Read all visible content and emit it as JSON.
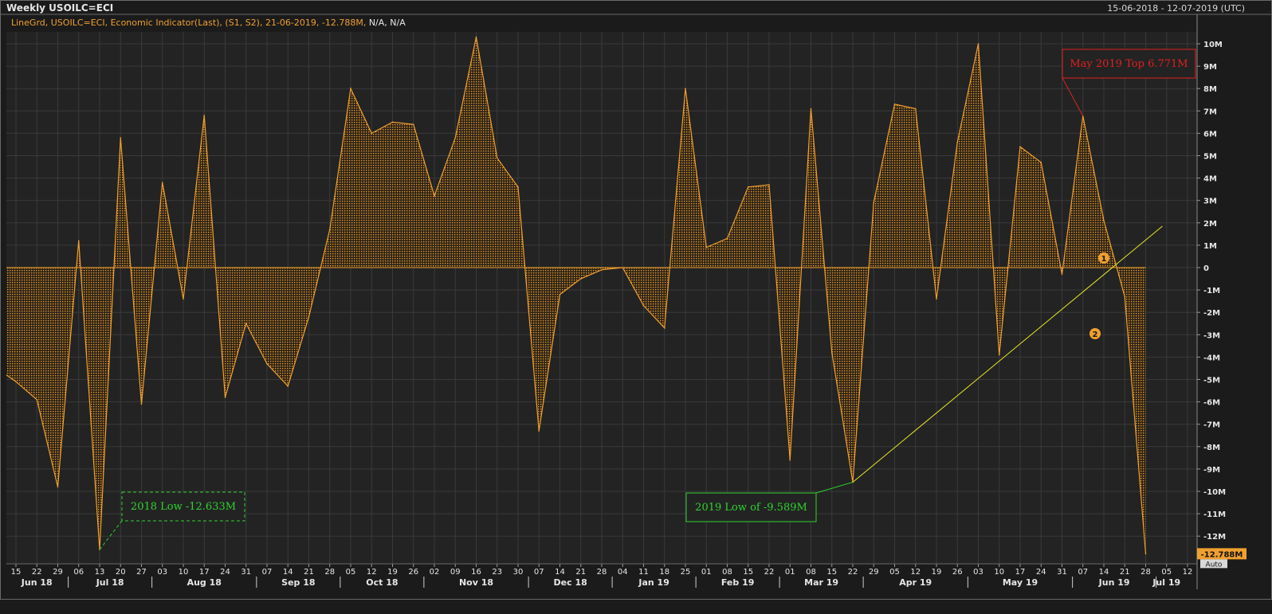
{
  "header": {
    "title": "Weekly USOILC=ECI",
    "date_range": "15-06-2018 - 12-07-2019 (UTC)",
    "legend_orange": "LineGrd, USOILC=ECI, Economic Indicator(Last), (S1, S2), 21-06-2019, -12.788M,",
    "legend_white": "N/A, N/A"
  },
  "colors": {
    "background": "#1b1b1b",
    "plot_bg": "#232323",
    "grid": "#3a3a3a",
    "series": "#f0a030",
    "trendline": "#e8e82a",
    "annotation_green": "#2fd32f",
    "annotation_red": "#e02020",
    "axis_text": "#e6e6e6"
  },
  "chart_data": {
    "type": "area",
    "series": [
      {
        "name": "USOILC=ECI",
        "values": [
          -5.1,
          -5.9,
          -9.8,
          1.2,
          -12.6,
          5.8,
          -6.1,
          3.8,
          -1.4,
          6.8,
          -5.8,
          -2.5,
          -4.3,
          -5.3,
          -2.2,
          1.7,
          8.0,
          6.0,
          6.5,
          6.4,
          3.2,
          5.8,
          10.3,
          4.9,
          3.6,
          -7.3,
          -1.2,
          -0.5,
          -0.1,
          0.0,
          -1.7,
          -2.7,
          8.0,
          0.9,
          1.3,
          3.6,
          3.7,
          -8.6,
          7.1,
          -3.8,
          -9.589,
          2.9,
          7.3,
          7.1,
          -1.4,
          5.6,
          10.0,
          -3.9,
          5.4,
          4.7,
          -0.3,
          6.771,
          2.1,
          -1.3,
          -12.788
        ]
      }
    ],
    "x_tick_labels": [
      "15",
      "22",
      "29",
      "06",
      "13",
      "20",
      "27",
      "03",
      "10",
      "17",
      "24",
      "31",
      "07",
      "14",
      "21",
      "28",
      "05",
      "12",
      "19",
      "26",
      "02",
      "09",
      "16",
      "23",
      "30",
      "07",
      "14",
      "21",
      "28",
      "04",
      "11",
      "18",
      "25",
      "01",
      "08",
      "15",
      "22",
      "01",
      "08",
      "15",
      "22",
      "29",
      "05",
      "12",
      "19",
      "26",
      "03",
      "10",
      "17",
      "24",
      "31",
      "07",
      "14",
      "21",
      "28",
      "05",
      "12"
    ],
    "month_labels": [
      {
        "label": "Jun 18",
        "tick": 0
      },
      {
        "label": "Jul 18",
        "tick": 3
      },
      {
        "label": "Aug 18",
        "tick": 7
      },
      {
        "label": "Sep 18",
        "tick": 12
      },
      {
        "label": "Oct 18",
        "tick": 16
      },
      {
        "label": "Nov 18",
        "tick": 20
      },
      {
        "label": "Dec 18",
        "tick": 25
      },
      {
        "label": "Jan 19",
        "tick": 29
      },
      {
        "label": "Feb 19",
        "tick": 33
      },
      {
        "label": "Mar 19",
        "tick": 37
      },
      {
        "label": "Apr 19",
        "tick": 41
      },
      {
        "label": "May 19",
        "tick": 46
      },
      {
        "label": "Jun 19",
        "tick": 51
      },
      {
        "label": "Jul 19",
        "tick": 55
      }
    ],
    "y_tick_labels": [
      "10M",
      "9M",
      "8M",
      "7M",
      "6M",
      "5M",
      "4M",
      "3M",
      "2M",
      "1M",
      "0",
      "-1M",
      "-2M",
      "-3M",
      "-4M",
      "-5M",
      "-6M",
      "-7M",
      "-8M",
      "-9M",
      "-10M",
      "-11M",
      "-12M"
    ],
    "ylim": [
      -13.2,
      10.8
    ],
    "last_value_label": "-12.788M",
    "auto_label": "Auto",
    "grid": true,
    "annotations": {
      "low_2018": {
        "text": "2018 Low -12.633M",
        "point_index": 4
      },
      "low_2019": {
        "text": "2019 Low of -9.589M",
        "point_index": 40
      },
      "top_2019": {
        "text": "May 2019 Top 6.771M",
        "point_index": 51
      },
      "marker_1": {
        "text": "1"
      },
      "marker_2": {
        "text": "2"
      }
    },
    "trendline": {
      "from_index": 40,
      "from_value": -9.589,
      "to_value": 1.85
    }
  }
}
